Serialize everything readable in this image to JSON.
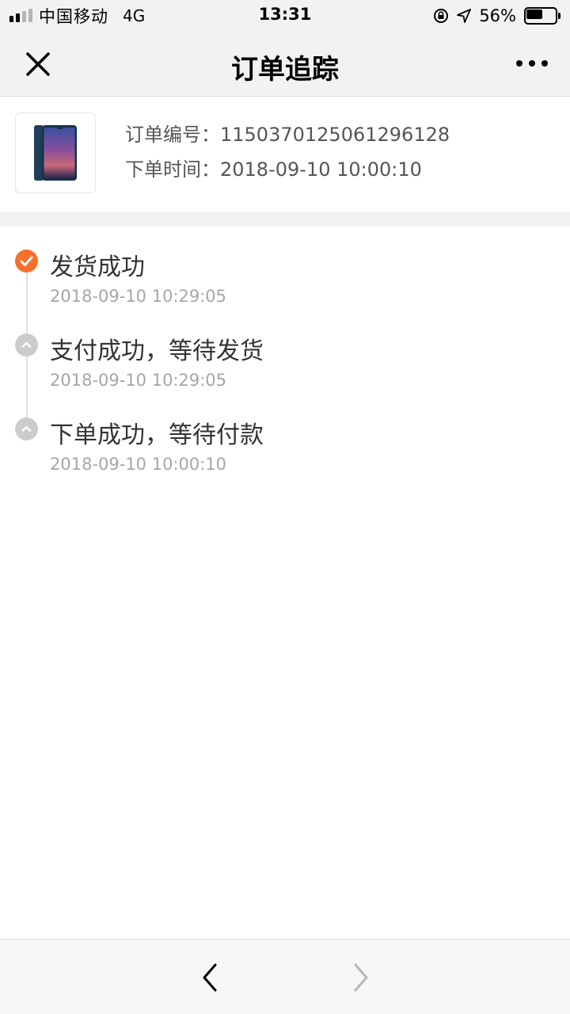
{
  "status_bar": {
    "carrier": "中国移动",
    "network": "4G",
    "time": "13:31",
    "battery_percent": "56%",
    "battery_level": 0.56,
    "signal_bars_filled": 2,
    "signal_bars_total": 4
  },
  "nav": {
    "title": "订单追踪",
    "close_icon": "close-icon",
    "more_icon": "more-icon"
  },
  "order": {
    "number_label": "订单编号：",
    "number_value": "1150370125061296128",
    "time_label": "下单时间：",
    "time_value": "2018-09-10 10:00:10"
  },
  "timeline": [
    {
      "title": "发货成功",
      "time": "2018-09-10 10:29:05",
      "state": "active"
    },
    {
      "title": "支付成功，等待发货",
      "time": "2018-09-10 10:29:05",
      "state": "inactive"
    },
    {
      "title": "下单成功，等待付款",
      "time": "2018-09-10 10:00:10",
      "state": "inactive"
    }
  ],
  "colors": {
    "accent": "#f5702a",
    "inactive_dot": "#cccccc",
    "bar_bg": "#f2f2f2",
    "muted_text": "#a6a6a6"
  },
  "bottom_bar": {
    "back_icon": "chevron-left-icon",
    "forward_icon": "chevron-right-icon",
    "forward_enabled": false
  }
}
